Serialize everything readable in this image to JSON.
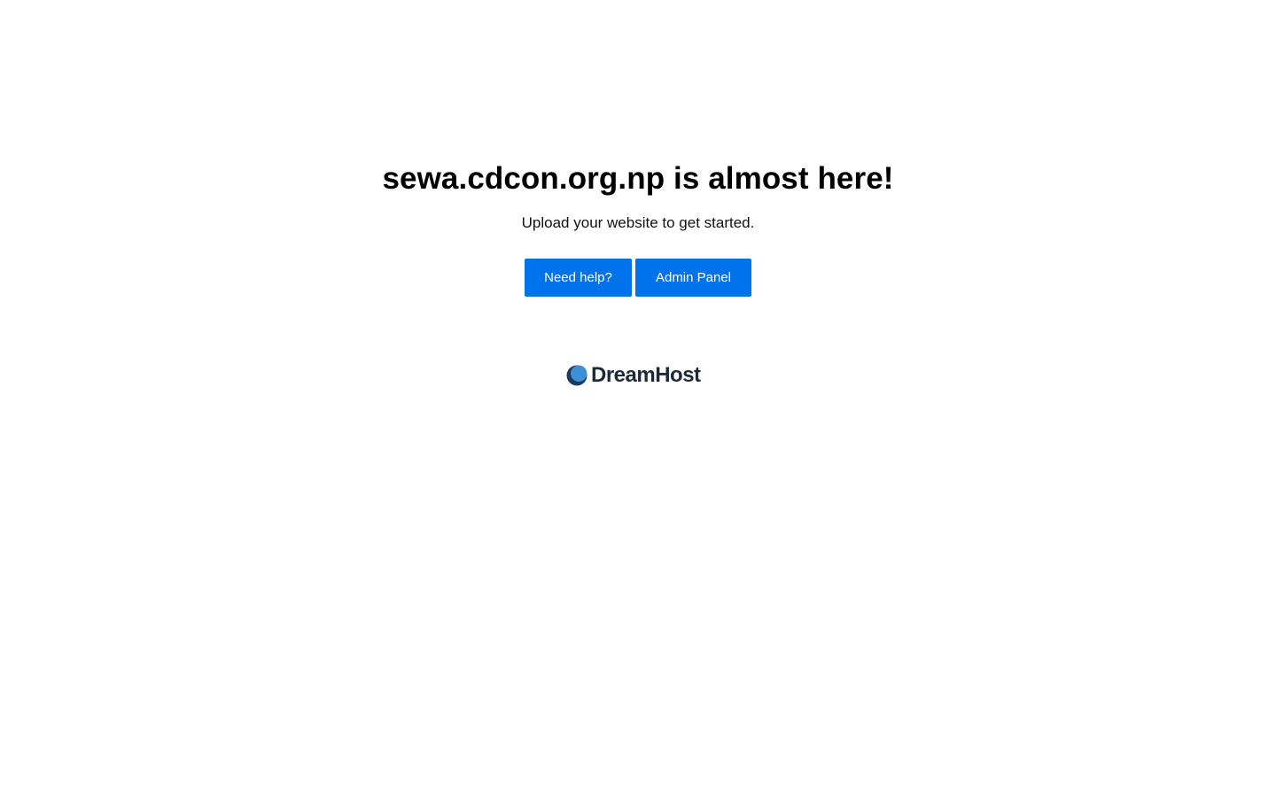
{
  "main": {
    "headline": "sewa.cdcon.org.np is almost here!",
    "subtitle": "Upload your website to get started.",
    "buttons": {
      "help_label": "Need help?",
      "admin_label": "Admin Panel"
    }
  },
  "footer": {
    "logo_icon": "dreamhost-moon-icon",
    "logo_text": "DreamHost"
  },
  "colors": {
    "button_bg": "#0073ec",
    "button_text": "#ffffff",
    "logo_text": "#1e2a3a",
    "logo_moon_light": "#3d8fd6",
    "logo_moon_dark": "#1e3a5c"
  }
}
